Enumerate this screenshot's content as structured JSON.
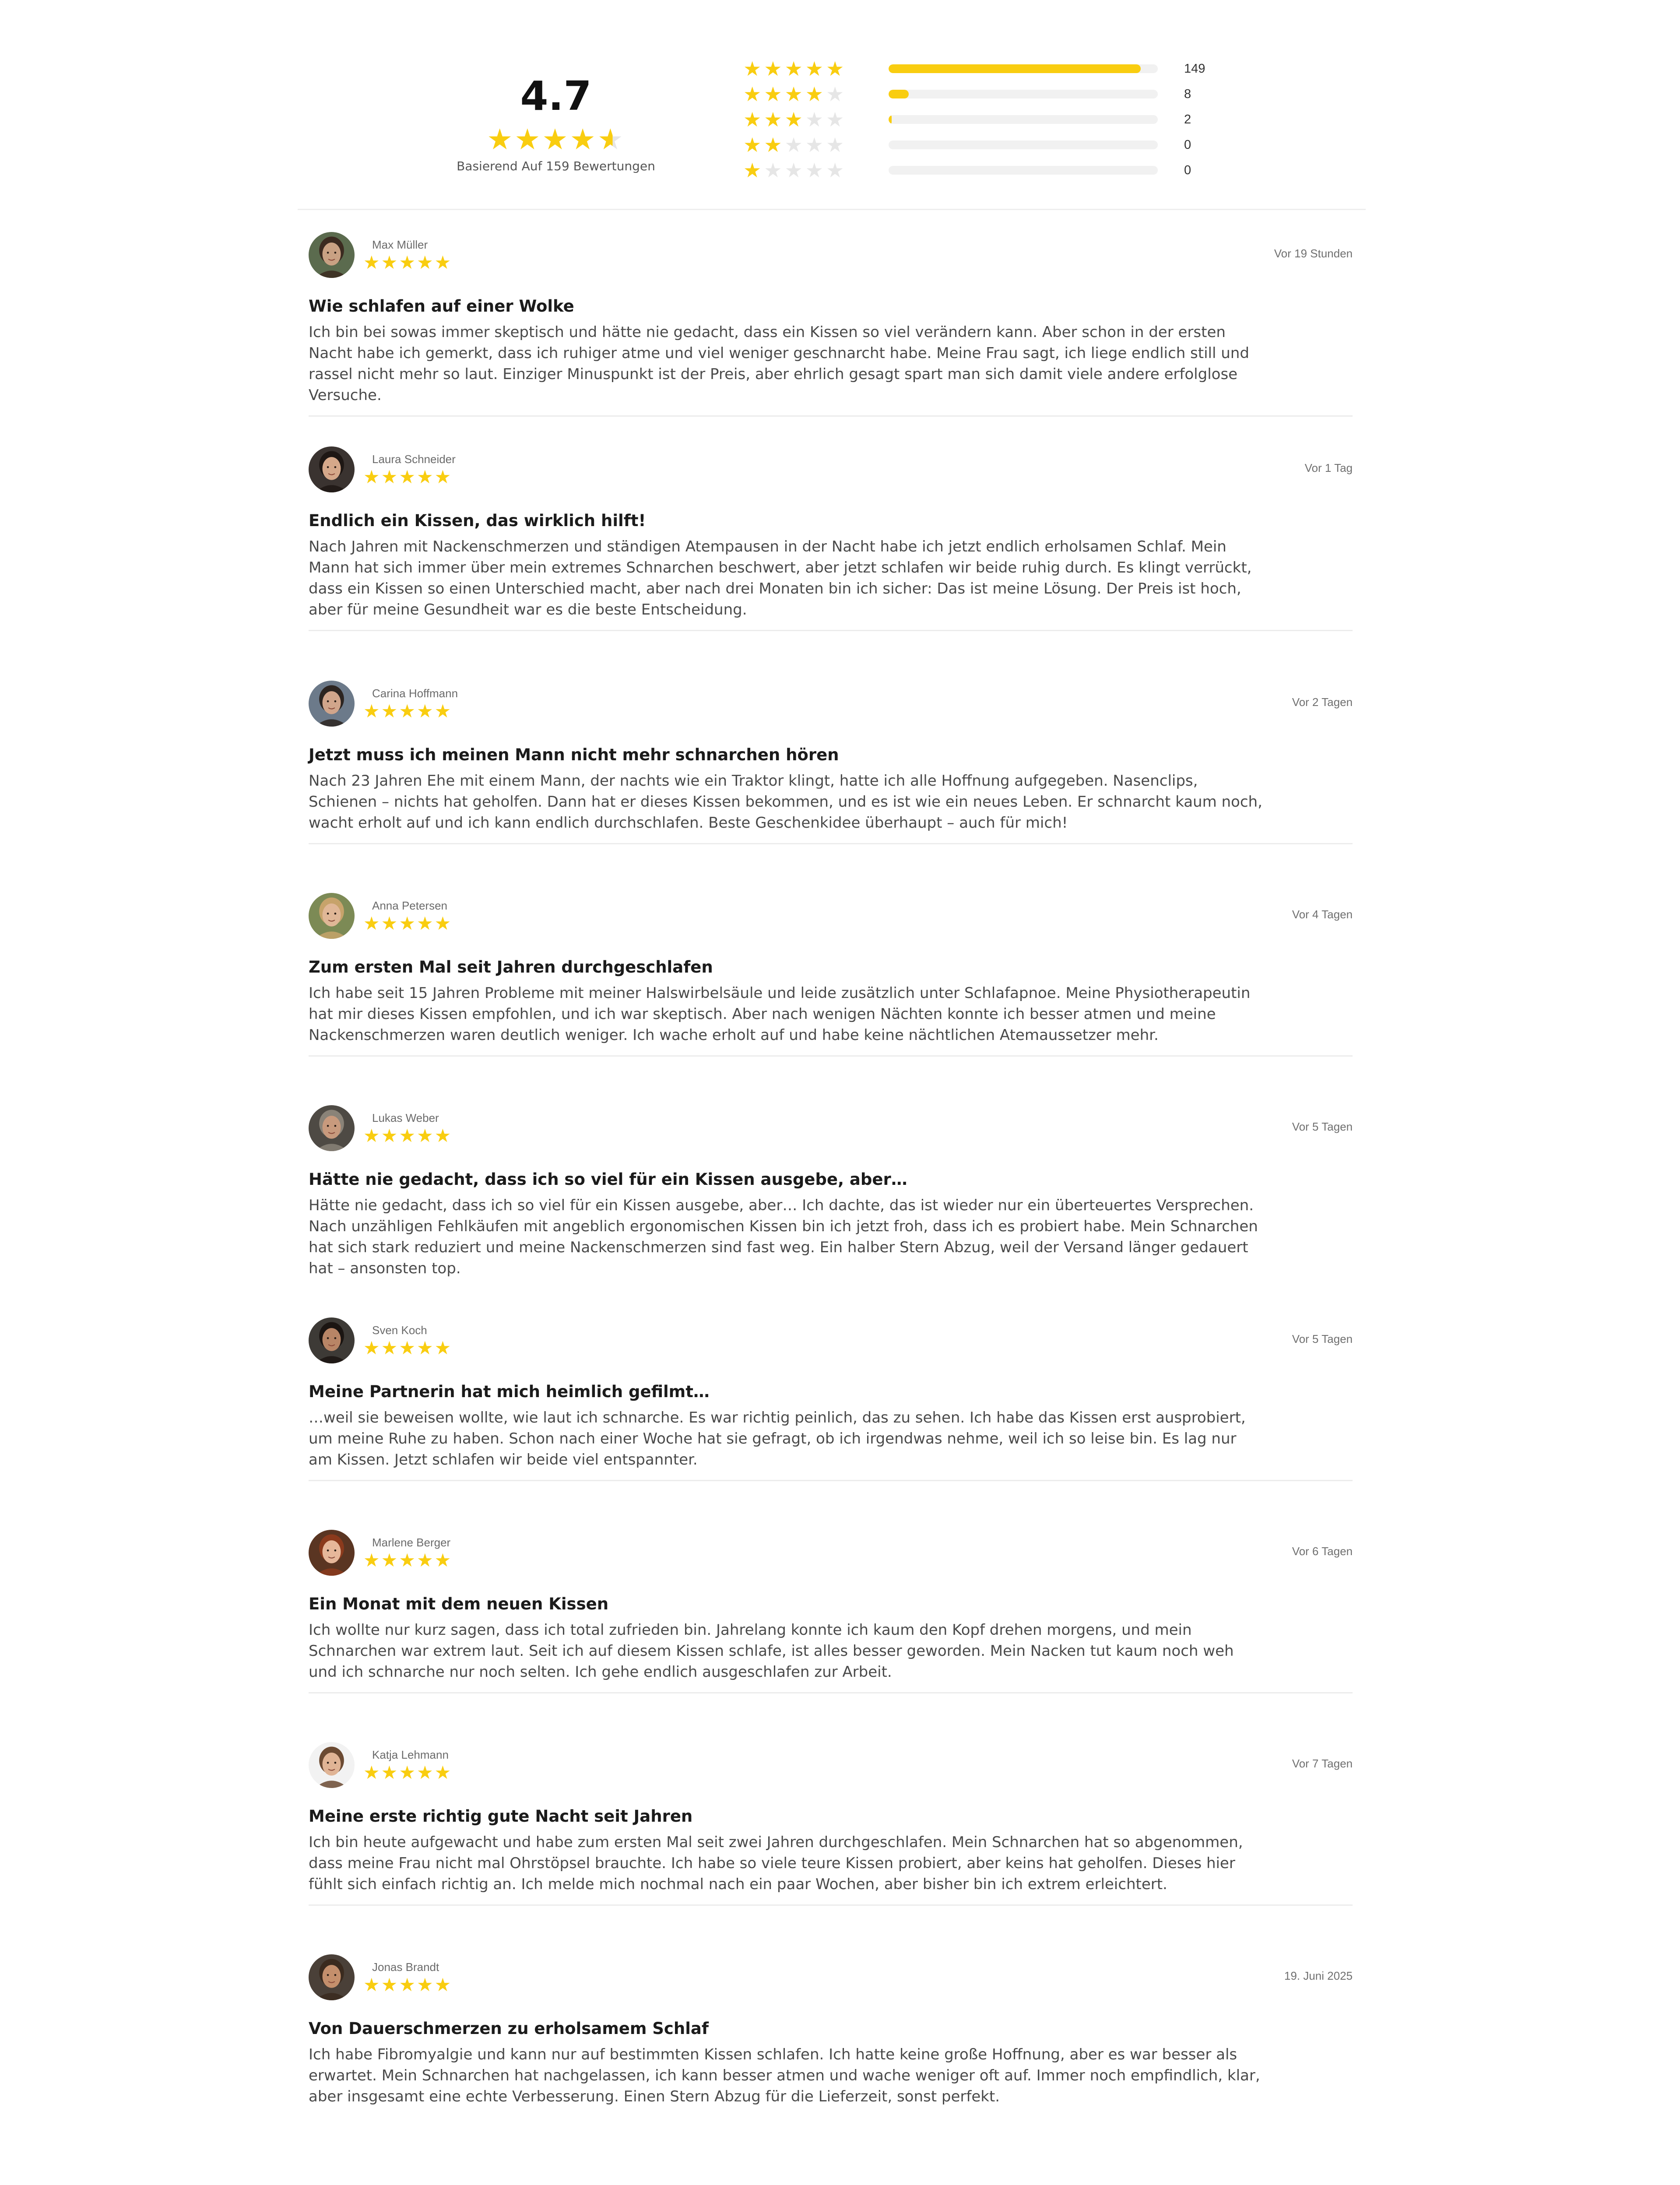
{
  "summary": {
    "average": "4.7",
    "average_stars": [
      "★",
      "★",
      "★",
      "★",
      "★"
    ],
    "caption": "Basierend Auf 159 Bewertungen",
    "distribution": [
      {
        "stars": 5,
        "count": "149",
        "fraction": 0.937
      },
      {
        "stars": 4,
        "count": "8",
        "fraction": 0.075
      },
      {
        "stars": 3,
        "count": "2",
        "fraction": 0.012
      },
      {
        "stars": 2,
        "count": "0",
        "fraction": 0
      },
      {
        "stars": 1,
        "count": "0",
        "fraction": 0
      }
    ],
    "star_color": "#f9cd10",
    "empty_star_color": "#e6e6e6"
  },
  "reviews": [
    {
      "name": "Max Müller",
      "rating": 5,
      "date": "Vor 19 Stunden",
      "title": "Wie schlafen auf einer Wolke",
      "body": "Ich bin bei sowas immer skeptisch und hätte nie gedacht, dass ein Kissen so viel verändern kann. Aber schon in der ersten Nacht habe ich gemerkt, dass ich ruhiger atme und viel weniger geschnarcht habe. Meine Frau sagt, ich liege endlich still und rassel nicht mehr so laut. Einziger Minuspunkt ist der Preis, aber ehrlich gesagt spart man sich damit viele andere erfolglose Versuche.",
      "avatar": {
        "bg": "#5b6b4e",
        "skin": "#c9a183",
        "hair": "#3b2a20"
      }
    },
    {
      "name": "Laura Schneider",
      "rating": 5,
      "date": "Vor 1 Tag",
      "title": "Endlich ein Kissen, das wirklich hilft!",
      "body": "Nach Jahren mit Nackenschmerzen und ständigen Atempausen in der Nacht habe ich jetzt endlich erholsamen Schlaf. Mein Mann hat sich immer über mein extremes Schnarchen beschwert, aber jetzt schlafen wir beide ruhig durch. Es klingt verrückt, dass ein Kissen so einen Unterschied macht, aber nach drei Monaten bin ich sicher: Das ist meine Lösung. Der Preis ist hoch, aber für meine Gesundheit war es die beste Entscheidung.",
      "avatar": {
        "bg": "#3a3330",
        "skin": "#d5a88a",
        "hair": "#1e1714"
      }
    },
    {
      "name": "Carina Hoffmann",
      "rating": 5,
      "date": "Vor 2 Tagen",
      "title": "Jetzt muss ich meinen Mann nicht mehr schnarchen hören",
      "body": "Nach 23 Jahren Ehe mit einem Mann, der nachts wie ein Traktor klingt, hatte ich alle Hoffnung aufgegeben. Nasenclips, Schienen – nichts hat geholfen. Dann hat er dieses Kissen bekommen, und es ist wie ein neues Leben. Er schnarcht kaum noch, wacht erholt auf und ich kann endlich durchschlafen. Beste Geschenkidee überhaupt – auch für mich!",
      "avatar": {
        "bg": "#6c7a8a",
        "skin": "#d1a58b",
        "hair": "#2c2420"
      }
    },
    {
      "name": "Anna Petersen",
      "rating": 5,
      "date": "Vor 4 Tagen",
      "title": "Zum ersten Mal seit Jahren durchgeschlafen",
      "body": "Ich habe seit 15 Jahren Probleme mit meiner Halswirbelsäule und leide zusätzlich unter Schlafapnoe. Meine Physiotherapeutin hat mir dieses Kissen empfohlen, und ich war skeptisch. Aber nach wenigen Nächten konnte ich besser atmen und meine Nackenschmerzen waren deutlich weniger. Ich wache erholt auf und habe keine nächtlichen Atemaussetzer mehr.",
      "avatar": {
        "bg": "#7c8a55",
        "skin": "#e0b797",
        "hair": "#c7a36b"
      }
    },
    {
      "name": "Lukas Weber",
      "rating": 5,
      "date": "Vor 5 Tagen",
      "title": "Hätte nie gedacht, dass ich so viel für ein Kissen ausgebe, aber…",
      "body": "Hätte nie gedacht, dass ich so viel für ein Kissen ausgebe, aber… Ich dachte, das ist wieder nur ein überteuertes Versprechen. Nach unzähligen Fehlkäufen mit angeblich ergonomischen Kissen bin ich jetzt froh, dass ich es probiert habe. Mein Schnarchen hat sich stark reduziert und meine Nackenschmerzen sind fast weg. Ein halber Stern Abzug, weil der Versand länger gedauert hat – ansonsten top.",
      "avatar": {
        "bg": "#4e4a44",
        "skin": "#c89a7d",
        "hair": "#8a8378"
      }
    },
    {
      "name": "Sven Koch",
      "rating": 5,
      "date": "Vor 5 Tagen",
      "title": "Meine Partnerin hat mich heimlich gefilmt…",
      "body": "…weil sie beweisen wollte, wie laut ich schnarche. Es war richtig peinlich, das zu sehen. Ich habe das Kissen erst ausprobiert, um meine Ruhe zu haben. Schon nach einer Woche hat sie gefragt, ob ich irgendwas nehme, weil ich so leise bin. Es lag nur am Kissen. Jetzt schlafen wir beide viel entspannter.",
      "avatar": {
        "bg": "#3d3a36",
        "skin": "#b88566",
        "hair": "#1b1512"
      }
    },
    {
      "name": "Marlene Berger",
      "rating": 5,
      "date": "Vor 6 Tagen",
      "title": "Ein Monat mit dem neuen Kissen",
      "body": "Ich wollte nur kurz sagen, dass ich total zufrieden bin. Jahrelang konnte ich kaum den Kopf drehen morgens, und mein Schnarchen war extrem laut. Seit ich auf diesem Kissen schlafe, ist alles besser geworden. Mein Nacken tut kaum noch weh und ich schnarche nur noch selten. Ich gehe endlich ausgeschlafen zur Arbeit.",
      "avatar": {
        "bg": "#5a3522",
        "skin": "#e6b79a",
        "hair": "#8b3a1c"
      }
    },
    {
      "name": "Katja Lehmann",
      "rating": 5,
      "date": "Vor 7 Tagen",
      "title": "Meine erste richtig gute Nacht seit Jahren",
      "body": "Ich bin heute aufgewacht und habe zum ersten Mal seit zwei Jahren durchgeschlafen. Mein Schnarchen hat so abgenommen, dass meine Frau nicht mal Ohrstöpsel brauchte. Ich habe so viele teure Kissen probiert, aber keins hat geholfen. Dieses hier fühlt sich einfach richtig an. Ich melde mich nochmal nach ein paar Wochen, aber bisher bin ich extrem erleichtert.",
      "avatar": {
        "bg": "#f2f2f2",
        "skin": "#e0b495",
        "hair": "#6b4a32"
      }
    },
    {
      "name": "Jonas Brandt",
      "rating": 5,
      "date": "19. Juni 2025",
      "title": "Von Dauerschmerzen zu erholsamem Schlaf",
      "body": "Ich habe Fibromyalgie und kann nur auf bestimmten Kissen schlafen. Ich hatte keine große Hoffnung, aber es war besser als erwartet. Mein Schnarchen hat nachgelassen, ich kann besser atmen und wache weniger oft auf. Immer noch empfindlich, klar, aber insgesamt eine echte Verbesserung. Einen Stern Abzug für die Lieferzeit, sonst perfekt.",
      "avatar": {
        "bg": "#4a4038",
        "skin": "#c48f6c",
        "hair": "#3a2a1e"
      }
    }
  ]
}
